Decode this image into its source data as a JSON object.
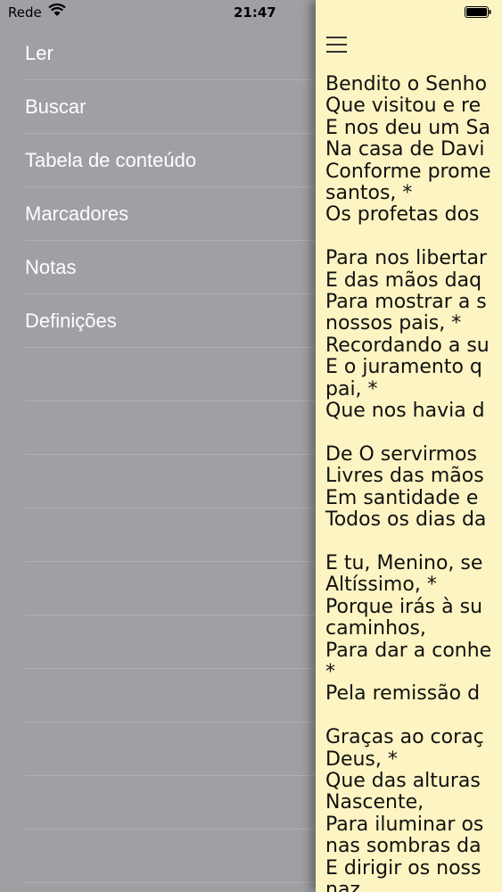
{
  "status_bar": {
    "carrier": "Rede",
    "time": "21:47"
  },
  "menu": {
    "items": [
      {
        "label": "Ler"
      },
      {
        "label": "Buscar"
      },
      {
        "label": "Tabela de conteúdo"
      },
      {
        "label": "Marcadores"
      },
      {
        "label": "Notas"
      },
      {
        "label": "Definições"
      }
    ]
  },
  "reader": {
    "text": "Bendito o Senho\nQue visitou e re\nE nos deu um Sa\nNa casa de Davi\nConforme prome\nsantos, *\nOs profetas dos \n\nPara nos libertar\nE das mãos daq\nPara mostrar a s\nnossos pais, *\nRecordando a su\nE o juramento q\npai, *\nQue nos havia d\n\nDe O servirmos \nLivres das mãos\nEm santidade e \nTodos os dias da\n\nE tu, Menino, se\nAltíssimo, *\nPorque irás à su\ncaminhos,\nPara dar a conhe\n*\nPela remissão d\n\nGraças ao coraç\nDeus, *\nQue das alturas \nNascente,\nPara iluminar os\nnas sombras da \nE dirigir os noss\nnaz"
  },
  "colors": {
    "menu_background": "#a09fa4",
    "reader_background": "#fcf4c2",
    "menu_text": "#ffffff"
  }
}
